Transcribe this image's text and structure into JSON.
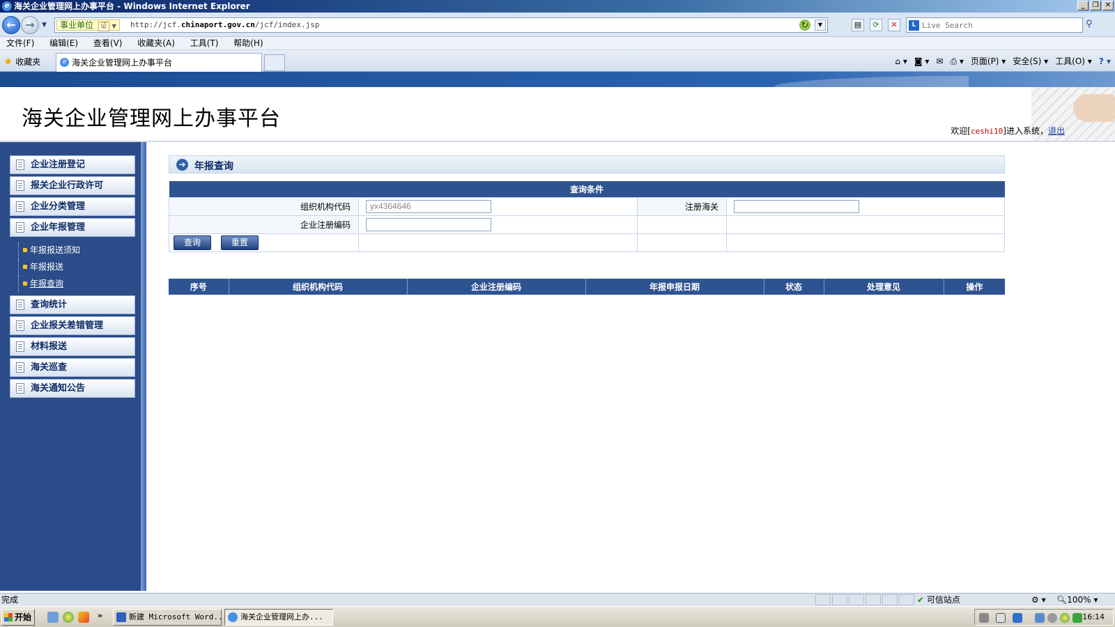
{
  "window": {
    "title": "海关企业管理网上办事平台 - Windows Internet Explorer",
    "controls": [
      "_",
      "❐",
      "✕"
    ]
  },
  "address": {
    "site_tag": "事业单位",
    "cert_tag": "证",
    "url_prefix": "http://jcf.",
    "url_domain": "chinaport.gov.cn",
    "url_path": "/jcf/index.jsp",
    "search_placeholder": "Live Search"
  },
  "menu": [
    "文件(F)",
    "编辑(E)",
    "查看(V)",
    "收藏夹(A)",
    "工具(T)",
    "帮助(H)"
  ],
  "tabs": {
    "favorites_label": "收藏夹",
    "active_tab": "海关企业管理网上办事平台",
    "commands": [
      "页面(P) ▾",
      "安全(S) ▾",
      "工具(O) ▾"
    ]
  },
  "header": {
    "title": "海关企业管理网上办事平台",
    "welcome_prefix": "欢迎[",
    "username": "ceshi10",
    "welcome_suffix": "]进入系统，",
    "logout": "退出"
  },
  "sidebar": {
    "items": [
      {
        "label": "企业注册登记"
      },
      {
        "label": "报关企业行政许可"
      },
      {
        "label": "企业分类管理"
      },
      {
        "label": "企业年报管理"
      },
      {
        "label": "查询统计"
      },
      {
        "label": "企业报关差错管理"
      },
      {
        "label": "材料报送"
      },
      {
        "label": "海关巡查"
      },
      {
        "label": "海关通知公告"
      }
    ],
    "subitems": [
      {
        "label": "年报报送须知"
      },
      {
        "label": "年报报送"
      },
      {
        "label": "年报查询"
      }
    ]
  },
  "content": {
    "title": "年报查询",
    "query": {
      "header": "查询条件",
      "org_code_label": "组织机构代码",
      "org_code_value": "yx4364646",
      "customs_label": "注册海关",
      "customs_value": "",
      "reg_no_label": "企业注册编码",
      "reg_no_value": "",
      "search_btn": "查询",
      "reset_btn": "重置"
    },
    "results": {
      "columns": [
        "序号",
        "组织机构代码",
        "企业注册编码",
        "年报申报日期",
        "状态",
        "处理意见",
        "操作"
      ],
      "rows": []
    }
  },
  "status": {
    "text": "完成",
    "zone": "可信站点",
    "zoom": "100%"
  },
  "taskbar": {
    "start": "开始",
    "tasks": [
      "新建 Microsoft Word...",
      "海关企业管理网上办..."
    ],
    "clock": "16:14"
  }
}
